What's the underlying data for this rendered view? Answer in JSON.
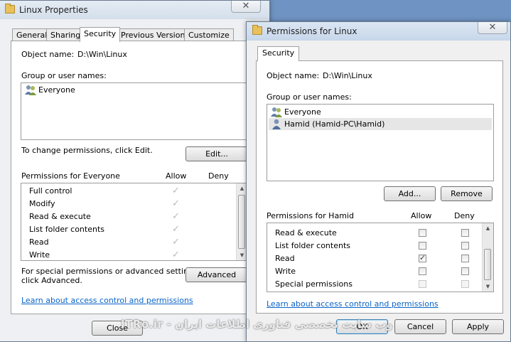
{
  "properties_window": {
    "title": "Linux Properties",
    "close_glyph": "✕",
    "tabs": [
      "General",
      "Sharing",
      "Security",
      "Previous Versions",
      "Customize"
    ],
    "selected_tab": "Security",
    "object_name_label": "Object name:",
    "object_name_value": "D:\\Win\\Linux",
    "group_label": "Group or user names:",
    "users": [
      {
        "name": "Everyone",
        "icon": "users-group-icon"
      }
    ],
    "change_text": "To change permissions, click Edit.",
    "edit_button": "Edit...",
    "permissions_label": "Permissions for Everyone",
    "allow_header": "Allow",
    "deny_header": "Deny",
    "permissions": [
      {
        "name": "Full control",
        "allow": true
      },
      {
        "name": "Modify",
        "allow": true
      },
      {
        "name": "Read & execute",
        "allow": true
      },
      {
        "name": "List folder contents",
        "allow": true
      },
      {
        "name": "Read",
        "allow": true
      },
      {
        "name": "Write",
        "allow": true
      }
    ],
    "special_text_1": "For special permissions or advanced settings,",
    "special_text_2": "click Advanced.",
    "advanced_button": "Advanced",
    "learn_link": "Learn about access control and permissions",
    "close_button": "Close"
  },
  "permissions_window": {
    "title": "Permissions for Linux",
    "close_glyph": "✕",
    "tab": "Security",
    "object_name_label": "Object name:",
    "object_name_value": "D:\\Win\\Linux",
    "group_label": "Group or user names:",
    "users": [
      {
        "name": "Everyone",
        "icon": "users-group-icon",
        "selected": false
      },
      {
        "name": "Hamid (Hamid-PC\\Hamid)",
        "icon": "user-icon",
        "selected": true
      }
    ],
    "add_button": "Add...",
    "remove_button": "Remove",
    "permissions_label": "Permissions for Hamid",
    "allow_header": "Allow",
    "deny_header": "Deny",
    "permissions": [
      {
        "name": "Read & execute",
        "allow": false,
        "deny": false,
        "disabled": false
      },
      {
        "name": "List folder contents",
        "allow": false,
        "deny": false,
        "disabled": false
      },
      {
        "name": "Read",
        "allow": true,
        "deny": false,
        "disabled": false
      },
      {
        "name": "Write",
        "allow": false,
        "deny": false,
        "disabled": false
      },
      {
        "name": "Special permissions",
        "allow": false,
        "deny": false,
        "disabled": true
      }
    ],
    "learn_link": "Learn about access control and permissions",
    "ok_button": "OK",
    "cancel_button": "Cancel",
    "apply_button": "Apply"
  },
  "watermark": "وب سایت تخصصی فناوری اطلاعات ایران - ITRo.ir"
}
